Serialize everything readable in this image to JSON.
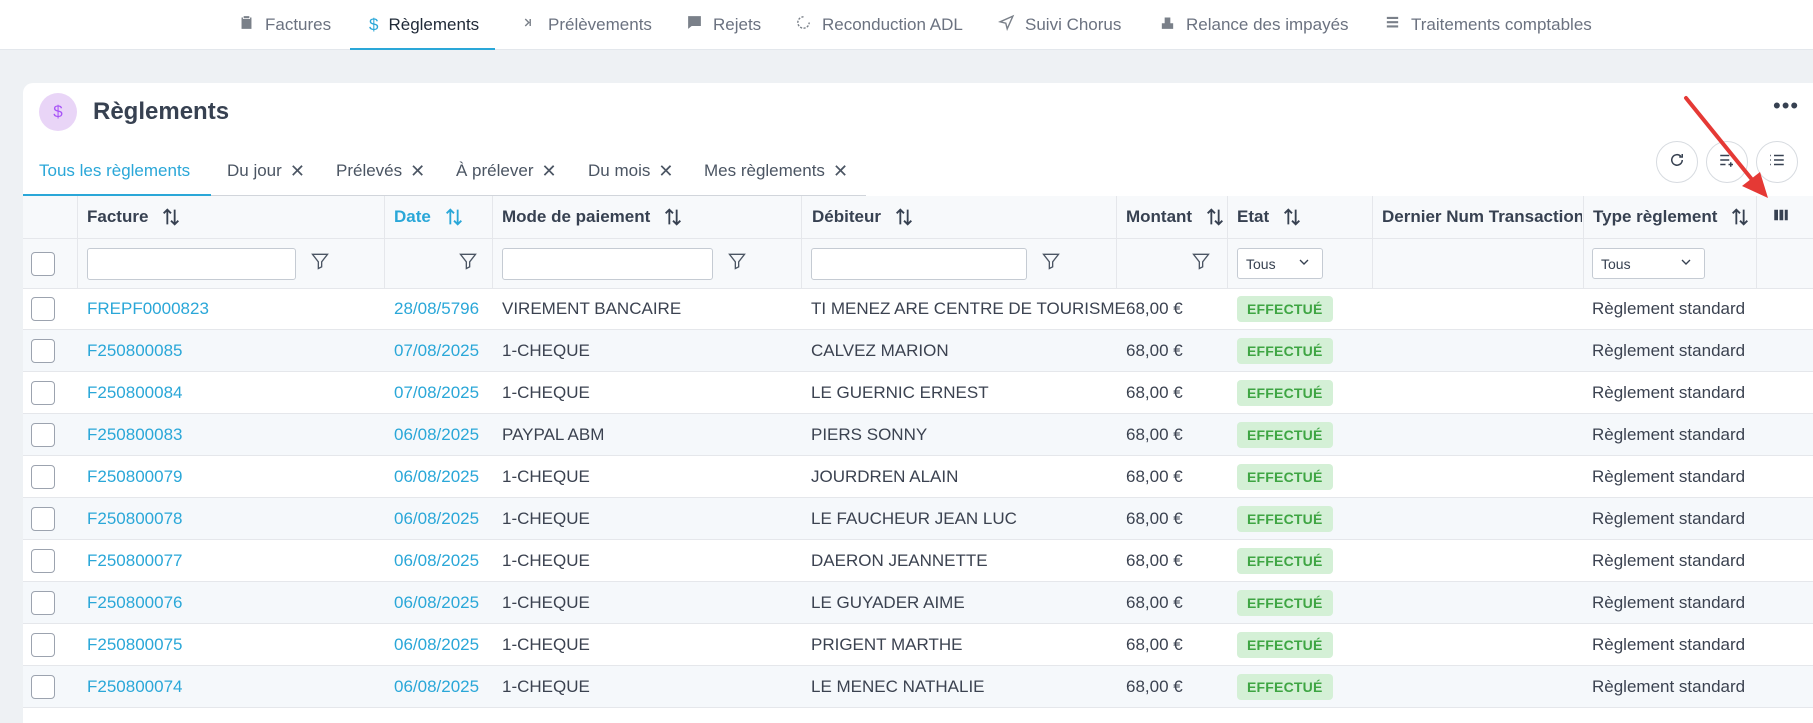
{
  "topnav": [
    {
      "label": "Factures",
      "icon": "clipboard-icon"
    },
    {
      "label": "Règlements",
      "icon": "dollar-icon",
      "active": true
    },
    {
      "label": "Prélèvements",
      "icon": "chevrons-right-icon"
    },
    {
      "label": "Rejets",
      "icon": "alert-message-icon"
    },
    {
      "label": "Reconduction ADL",
      "icon": "rotate-icon"
    },
    {
      "label": "Suivi Chorus",
      "icon": "send-icon"
    },
    {
      "label": "Relance des impayés",
      "icon": "stamp-icon"
    },
    {
      "label": "Traitements comptables",
      "icon": "list-icon"
    }
  ],
  "page": {
    "avatar_symbol": "$",
    "title": "Règlements",
    "more": "•••"
  },
  "filter_tabs": [
    {
      "label": "Tous les règlements",
      "active": true,
      "closable": false
    },
    {
      "label": "Du jour",
      "closable": true
    },
    {
      "label": "Prélevés",
      "closable": true
    },
    {
      "label": "À prélever",
      "closable": true
    },
    {
      "label": "Du mois",
      "closable": true
    },
    {
      "label": "Mes règlements",
      "closable": true
    }
  ],
  "close_glyph": "✕",
  "table": {
    "columns": [
      {
        "label": "Facture",
        "sortable": true
      },
      {
        "label": "Date",
        "sortable": true,
        "active": true
      },
      {
        "label": "Mode de paiement",
        "sortable": true
      },
      {
        "label": "Débiteur",
        "sortable": true
      },
      {
        "label": "Montant",
        "sortable": true
      },
      {
        "label": "Etat",
        "sortable": true
      },
      {
        "label": "Dernier Num Transaction",
        "sortable": false
      },
      {
        "label": "Type règlement",
        "sortable": true
      }
    ],
    "filters": {
      "etat_select": "Tous",
      "type_select": "Tous"
    },
    "rows": [
      [
        "FREPF0000823",
        "28/08/5796",
        "VIREMENT BANCAIRE",
        "TI MENEZ ARE CENTRE DE TOURISME",
        "68,00 €",
        "EFFECTUÉ",
        "",
        "Règlement standard"
      ],
      [
        "F250800085",
        "07/08/2025",
        "1-CHEQUE",
        "CALVEZ MARION",
        "68,00 €",
        "EFFECTUÉ",
        "",
        "Règlement standard"
      ],
      [
        "F250800084",
        "07/08/2025",
        "1-CHEQUE",
        "LE GUERNIC ERNEST",
        "68,00 €",
        "EFFECTUÉ",
        "",
        "Règlement standard"
      ],
      [
        "F250800083",
        "06/08/2025",
        "PAYPAL ABM",
        "PIERS SONNY",
        "68,00 €",
        "EFFECTUÉ",
        "",
        "Règlement standard"
      ],
      [
        "F250800079",
        "06/08/2025",
        "1-CHEQUE",
        "JOURDREN ALAIN",
        "68,00 €",
        "EFFECTUÉ",
        "",
        "Règlement standard"
      ],
      [
        "F250800078",
        "06/08/2025",
        "1-CHEQUE",
        "LE FAUCHEUR JEAN LUC",
        "68,00 €",
        "EFFECTUÉ",
        "",
        "Règlement standard"
      ],
      [
        "F250800077",
        "06/08/2025",
        "1-CHEQUE",
        "DAERON JEANNETTE",
        "68,00 €",
        "EFFECTUÉ",
        "",
        "Règlement standard"
      ],
      [
        "F250800076",
        "06/08/2025",
        "1-CHEQUE",
        "LE GUYADER AIME",
        "68,00 €",
        "EFFECTUÉ",
        "",
        "Règlement standard"
      ],
      [
        "F250800075",
        "06/08/2025",
        "1-CHEQUE",
        "PRIGENT MARTHE",
        "68,00 €",
        "EFFECTUÉ",
        "",
        "Règlement standard"
      ],
      [
        "F250800074",
        "06/08/2025",
        "1-CHEQUE",
        "LE MENEC NATHALIE",
        "68,00 €",
        "EFFECTUÉ",
        "",
        "Règlement standard"
      ]
    ]
  },
  "colors": {
    "accent": "#2aa7d8",
    "success_bg": "#d4f0d6",
    "success_text": "#3ea543",
    "annotation_arrow": "#e53935"
  }
}
